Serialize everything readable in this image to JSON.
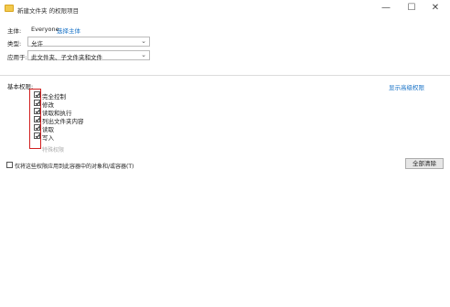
{
  "window": {
    "title": "新建文件夹 的权限项目",
    "minimize_glyph": "—",
    "maximize_glyph": "☐",
    "close_glyph": "✕"
  },
  "principal": {
    "label": "主体:",
    "value": "Everyone",
    "select_link": "选择主体"
  },
  "type": {
    "label": "类型:",
    "value": "允许"
  },
  "applies_to": {
    "label": "应用于:",
    "value": "此文件夹、子文件夹和文件"
  },
  "basic_permissions": {
    "label": "基本权限:",
    "show_advanced_link": "显示高级权限",
    "items": [
      {
        "label": "完全控制",
        "checked": true
      },
      {
        "label": "修改",
        "checked": true
      },
      {
        "label": "读取和执行",
        "checked": true
      },
      {
        "label": "列出文件夹内容",
        "checked": true
      },
      {
        "label": "读取",
        "checked": true
      },
      {
        "label": "写入",
        "checked": true
      }
    ],
    "faded_label": "特殊权限"
  },
  "apply_only": {
    "label": "仅将这些权限应用到此容器中的对象和/或容器(T)",
    "checked": false
  },
  "clear_all_button": "全部清除",
  "colors": {
    "link": "#1a73c7",
    "highlight_box": "#d21f1f"
  }
}
